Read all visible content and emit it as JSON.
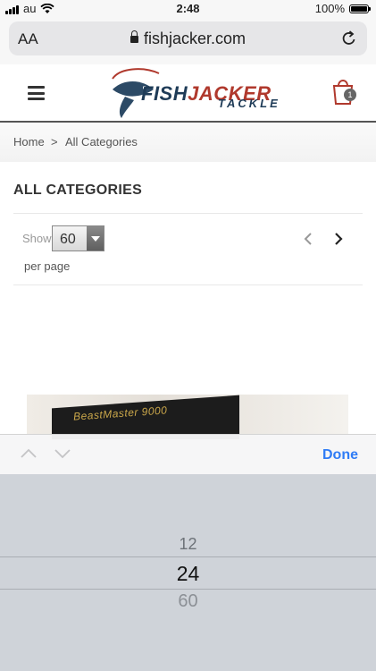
{
  "status_bar": {
    "carrier": "au",
    "time": "2:48",
    "battery": "100%"
  },
  "browser": {
    "text_size_label": "AA",
    "url": "fishjacker.com"
  },
  "logo": {
    "text_fish": "FISH",
    "text_jacker": "JACKER",
    "text_tackle": "TACKLE"
  },
  "header": {
    "cart_count": "1"
  },
  "breadcrumb": {
    "home": "Home",
    "separator": ">",
    "current": "All Categories"
  },
  "page": {
    "title": "ALL CATEGORIES"
  },
  "toolbar": {
    "show_label": "Show",
    "per_page_value": "60",
    "per_page_label": "per page"
  },
  "product": {
    "image_label": "BeastMaster 9000"
  },
  "keyboard_accessory": {
    "done_label": "Done"
  },
  "picker": {
    "options": [
      "12",
      "24",
      "60"
    ],
    "selected_index": 1
  },
  "colors": {
    "accent": "#2f7cf6",
    "brand_blue": "#1e3b57",
    "brand_red": "#b0392d"
  }
}
